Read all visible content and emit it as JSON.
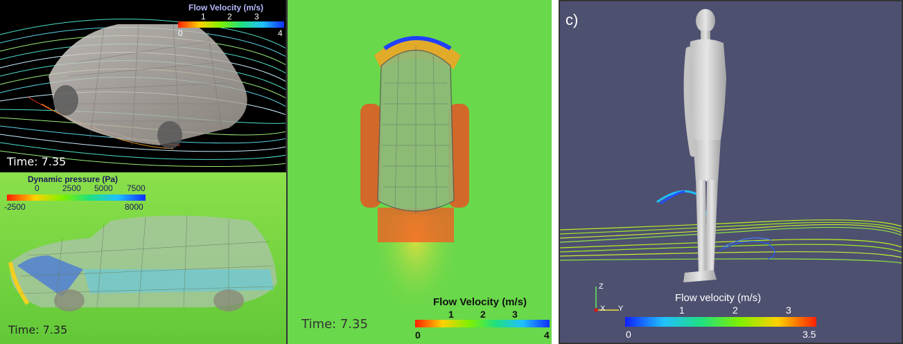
{
  "panel_a": {
    "time_label": "Time: 7.35",
    "colorbar": {
      "title": "Flow Velocity (m/s)",
      "top_ticks": [
        "1",
        "2",
        "3"
      ],
      "bottom_ticks": [
        "0",
        "4"
      ]
    }
  },
  "panel_b": {
    "time_label": "Time: 7.35",
    "colorbar": {
      "title": "Dynamic pressure (Pa)",
      "top_ticks": [
        "0",
        "2500",
        "5000",
        "7500"
      ],
      "bottom_ticks": [
        "-2500",
        "8000"
      ]
    }
  },
  "panel_top": {
    "time_label": "Time: 7.35",
    "colorbar": {
      "title": "Flow Velocity (m/s)",
      "top_ticks": [
        "1",
        "2",
        "3"
      ],
      "bottom_ticks": [
        "0",
        "4"
      ]
    }
  },
  "panel_c": {
    "panel_label": "c)",
    "axes": {
      "z": "Z",
      "x": "X",
      "y": "Y"
    },
    "colorbar": {
      "title": "Flow velocity (m/s)",
      "top_ticks": [
        "1",
        "2",
        "3"
      ],
      "bottom_ticks": [
        "0",
        "3.5"
      ]
    }
  },
  "colors": {
    "background_c": "#4e5070",
    "field_green": "#69d84a",
    "hot": "#ff3a1a",
    "cold": "#1a3cff"
  }
}
